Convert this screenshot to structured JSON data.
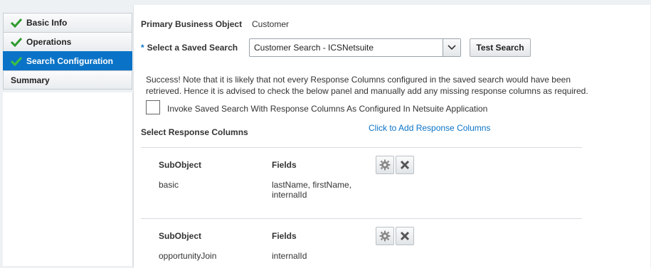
{
  "steps": [
    {
      "label": "Basic Info",
      "done": true
    },
    {
      "label": "Operations",
      "done": true
    },
    {
      "label": "Search Configuration",
      "done": true,
      "active": true
    },
    {
      "label": "Summary",
      "done": false
    }
  ],
  "form": {
    "primary_label": "Primary Business Object",
    "primary_value": "Customer",
    "required_star": "*",
    "saved_search_label": "Select a Saved Search",
    "saved_search_value": "Customer Search - ICSNetsuite",
    "test_search_label": "Test Search"
  },
  "message": {
    "line1": "Success! Note that it is likely that not every Response Columns configured in the saved search would have been",
    "line2": "retrieved. Hence it is advised to check the below panel and manually add any missing response columns as required."
  },
  "invoke_checkbox": {
    "label": "Invoke Saved Search With Response Columns As Configured In Netsuite Application",
    "checked": false
  },
  "response_columns": {
    "title": "Select Response Columns",
    "add_link": "Click to Add Response Columns",
    "subobject_header": "SubObject",
    "fields_header": "Fields",
    "rows": [
      {
        "subobject": "basic",
        "fields_line1": "lastName, firstName,",
        "fields_line2": "internalId"
      },
      {
        "subobject": "opportunityJoin",
        "fields_line1": "internalId",
        "fields_line2": ""
      }
    ]
  },
  "colors": {
    "accent": "#0a73c7",
    "check_green": "#2e9a2e"
  }
}
